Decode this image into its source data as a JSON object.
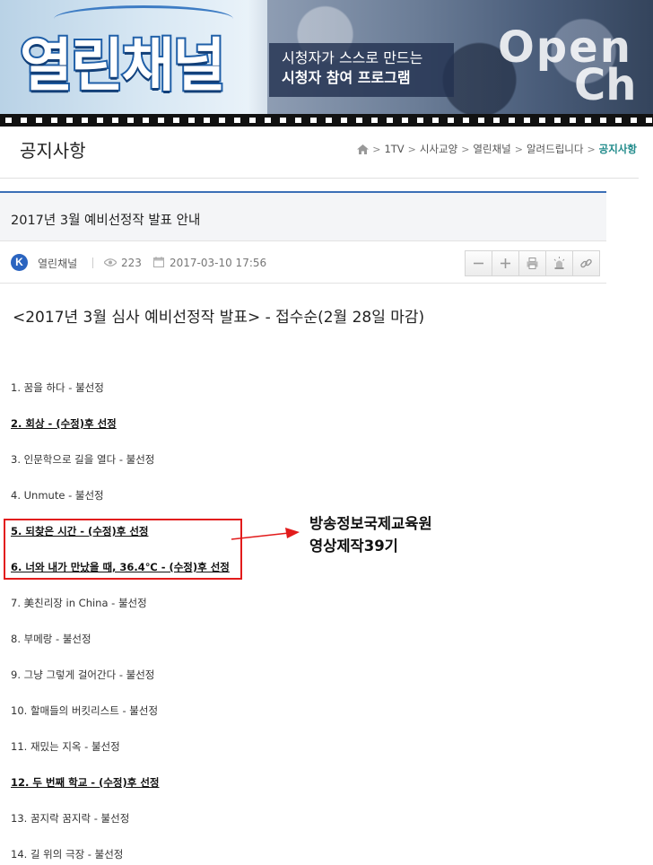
{
  "banner": {
    "logo_text": "열린채널",
    "slogan_line1": "시청자가 스스로 만드는",
    "slogan_line2": "시청자 참여 프로그램",
    "open_text_1": "Open",
    "open_text_2": "Ch"
  },
  "header": {
    "page_title": "공지사항",
    "breadcrumb": [
      "1TV",
      "시사교양",
      "열린채널",
      "알려드립니다",
      "공지사항"
    ],
    "home_icon": "home-icon"
  },
  "article": {
    "title": "2017년 3월 예비선정작 발표 안내",
    "author_initial": "K",
    "author": "열린채널",
    "views": "223",
    "date": "2017-03-10 17:56",
    "tools": [
      "minus-icon",
      "plus-icon",
      "print-icon",
      "alert-icon",
      "link-icon"
    ]
  },
  "body": {
    "heading": "<2017년 3월 심사 예비선정작 발표> - 접수순(2월 28일 마감)",
    "items": [
      {
        "text": "1. 꿈을 하다 - 불선정",
        "selected": false
      },
      {
        "text": "2. 회상 - (수정)후 선정",
        "selected": true
      },
      {
        "text": "3. 인문학으로 길을 열다 - 불선정",
        "selected": false
      },
      {
        "text": "4. Unmute - 불선정",
        "selected": false
      },
      {
        "text": "5. 되찾은 시간 - (수정)후 선정",
        "selected": true
      },
      {
        "text": "6. 너와 내가 만났을 때, 36.4℃ - (수정)후 선정",
        "selected": true
      },
      {
        "text": "7. 美친리장 in China - 불선정",
        "selected": false
      },
      {
        "text": "8. 부메랑 - 불선정",
        "selected": false
      },
      {
        "text": "9. 그냥 그렇게 걸어간다 - 불선정",
        "selected": false
      },
      {
        "text": "10. 할매들의 버킷리스트 - 불선정",
        "selected": false
      },
      {
        "text": "11. 재밌는 지옥 - 불선정",
        "selected": false
      },
      {
        "text": "12. 두 번째 학교 - (수정)후 선정",
        "selected": true
      },
      {
        "text": "13. 꿈지락 꿈지락 - 불선정",
        "selected": false
      },
      {
        "text": "14. 길 위의 극장 - 불선정",
        "selected": false
      }
    ]
  },
  "annotation": {
    "line1": "방송정보국제교육원",
    "line2": "영상제작39기",
    "color": "#e21b1b"
  }
}
